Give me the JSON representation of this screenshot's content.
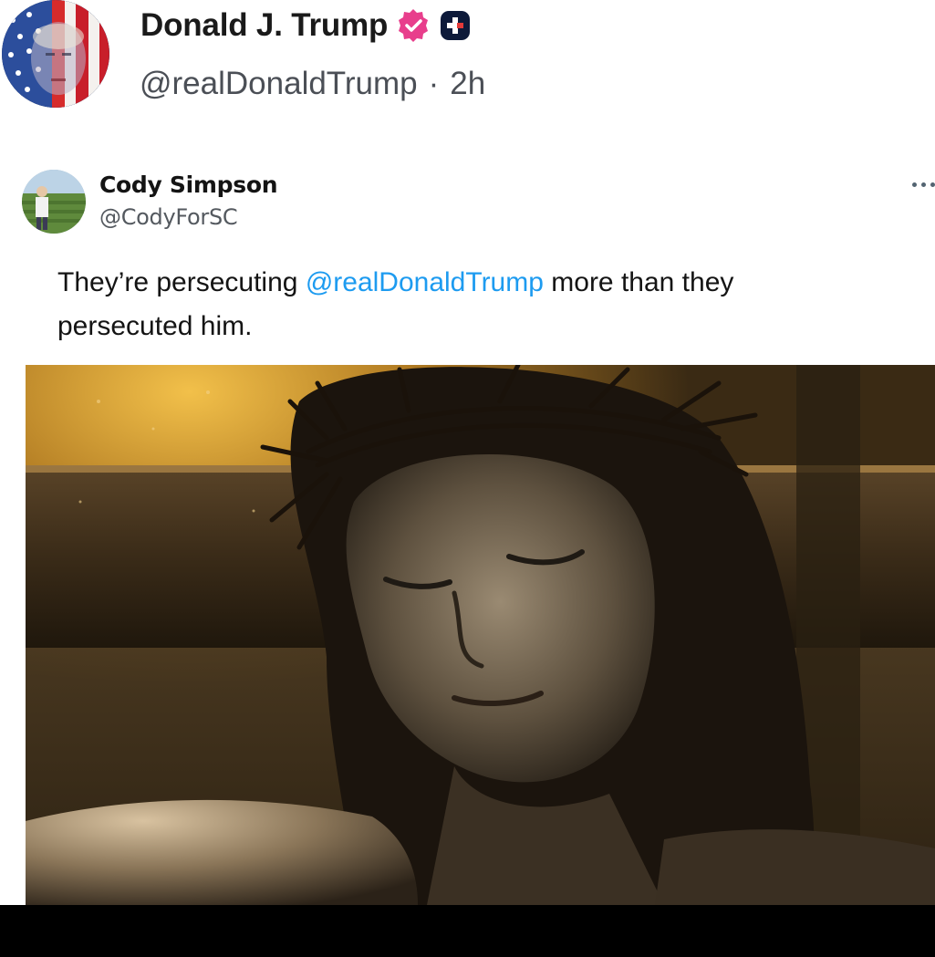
{
  "post": {
    "author": {
      "display_name": "Donald J. Trump",
      "handle": "@realDonaldTrump",
      "separator": "·",
      "time": "2h",
      "verified_badge_color": "#e83e8c",
      "avatar_icon": "flag-portrait-avatar"
    }
  },
  "quoted_post": {
    "author": {
      "display_name": "Cody Simpson",
      "handle": "@CodyForSC",
      "avatar_icon": "field-photo-avatar"
    },
    "more_icon": "more-dots-icon",
    "text_before": "They’re persecuting",
    "mention": "@realDonaldTrump",
    "text_after": "more than they persecuted him.",
    "mention_color": "#1d9bf0",
    "media": {
      "kind": "image",
      "description_icon": "crucifixion-portrait-image"
    }
  }
}
